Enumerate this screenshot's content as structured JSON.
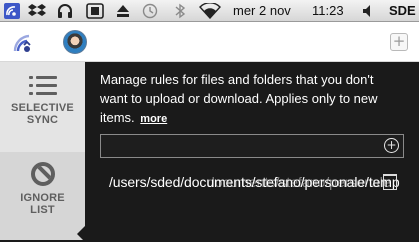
{
  "menubar": {
    "icons": [
      "wifi-sync-icon",
      "dropbox-icon",
      "headphones-icon",
      "screen-record-icon",
      "eject-icon",
      "time-machine-icon",
      "bluetooth-icon",
      "wifi-icon",
      "volume-icon"
    ],
    "date": "mer 2 nov",
    "time": "11:23",
    "user": "SDE"
  },
  "header": {
    "logo_icon": "wifi-sync-icon",
    "avatar_icon": "avatar",
    "add_icon": "plus-square-icon"
  },
  "sidebar": {
    "items": [
      {
        "label_line1": "SELECTIVE",
        "label_line2": "SYNC",
        "icon": "list-icon",
        "selected": false
      },
      {
        "label_line1": "IGNORE",
        "label_line2": "LIST",
        "icon": "ban-icon",
        "selected": true
      }
    ]
  },
  "main": {
    "description": "Manage rules for files and folders that you don't want to upload or download. Applies only to new items.",
    "more_link": "more",
    "input": {
      "value": "",
      "placeholder": ""
    },
    "ignore_rules": [
      {
        "path": "/users/sded/documents/stefano/personale/temp",
        "ghost": "documents/stefano/personale"
      }
    ]
  }
}
